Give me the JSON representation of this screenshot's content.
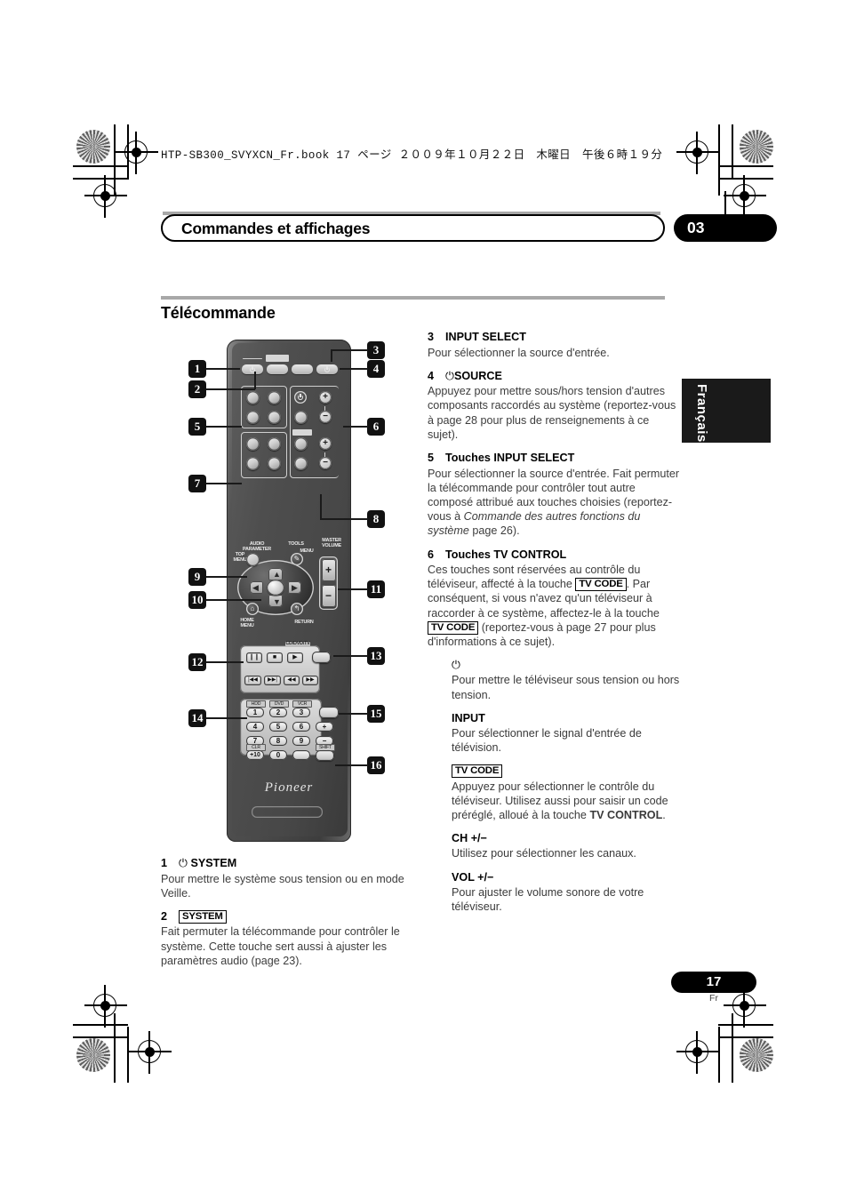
{
  "header": {
    "book_line": "HTP-SB300_SVYXCN_Fr.book   17 ページ   ２００９年１０月２２日　木曜日　午後６時１９分",
    "chapter_title": "Commandes et affichages",
    "chapter_number": "03",
    "language_tab": "Français"
  },
  "section": {
    "title": "Télécommande"
  },
  "footer": {
    "page_number": "17",
    "page_lang": "Fr"
  },
  "colors": {
    "accent_black": "#000000",
    "rule_gray": "#a8a8a8",
    "body_text": "#3d3d3d"
  },
  "callouts": [
    {
      "id": "1",
      "label": "1"
    },
    {
      "id": "2",
      "label": "2"
    },
    {
      "id": "3",
      "label": "3"
    },
    {
      "id": "4",
      "label": "4"
    },
    {
      "id": "5",
      "label": "5"
    },
    {
      "id": "6",
      "label": "6"
    },
    {
      "id": "7",
      "label": "7"
    },
    {
      "id": "8",
      "label": "8"
    },
    {
      "id": "9",
      "label": "9"
    },
    {
      "id": "10",
      "label": "10"
    },
    {
      "id": "11",
      "label": "11"
    },
    {
      "id": "12",
      "label": "12"
    },
    {
      "id": "13",
      "label": "13"
    },
    {
      "id": "14",
      "label": "14"
    },
    {
      "id": "15",
      "label": "15"
    },
    {
      "id": "16",
      "label": "16"
    }
  ],
  "remote": {
    "labels": {
      "audio_parameter": "AUDIO\nPARAMETER",
      "top_menu": "TOP\nMENU",
      "tools": "TOOLS",
      "menu": "MENU",
      "master_volume": "MASTER\nVOLUME",
      "home_menu": "HOME\nMENU",
      "return": "RETURN",
      "cd_dvd_tv": "CD/DVD/TV",
      "shift": "SHIFT",
      "clr": "CLR",
      "brand": "Pioneer"
    },
    "source_labels": [
      "HDD",
      "DVD",
      "VCR"
    ],
    "keypad": [
      "1",
      "2",
      "3",
      "4",
      "5",
      "6",
      "7",
      "8",
      "9",
      "+10",
      "0"
    ],
    "vol_plus": "+",
    "vol_minus": "−",
    "arrows": {
      "up": "▲",
      "down": "▼",
      "left": "◀",
      "right": "▶"
    },
    "transport": {
      "pause": "❙❙",
      "stop": "■",
      "play": "▶",
      "prev": "|◀◀",
      "next": "▶▶|",
      "rew": "◀◀",
      "ff": "▶▶"
    }
  },
  "left_column": [
    {
      "num": "1",
      "head_prefix": "⏻",
      "head": "SYSTEM",
      "body": "Pour mettre le système sous tension ou en mode Veille."
    },
    {
      "num": "2",
      "boxed": "SYSTEM",
      "body": "Fait permuter la télécommande pour contrôler le système. Cette touche sert aussi à ajuster les paramètres audio (page 23)."
    }
  ],
  "right_column": [
    {
      "num": "3",
      "head": "INPUT SELECT",
      "body": "Pour sélectionner la source d'entrée."
    },
    {
      "num": "4",
      "head_prefix": "⏻",
      "head": "SOURCE",
      "body": "Appuyez pour mettre sous/hors tension d'autres composants raccordés au système (reportez-vous à page 28 pour plus de renseignements à ce sujet)."
    },
    {
      "num": "5",
      "head": "Touches INPUT SELECT",
      "body_part1": "Pour sélectionner la source d'entrée. Fait permuter la télécommande pour contrôler tout autre composé attribué aux touches choisies (reportez-vous à ",
      "body_italic": "Commande des autres fonctions du système",
      "body_part2": " page 26)."
    },
    {
      "num": "6",
      "head": "Touches TV CONTROL",
      "body_part1": "Ces touches sont réservées au contrôle du téléviseur, affecté à la touche ",
      "boxed1": "TV CODE",
      "body_part2": ". Par conséquent, si vous n'avez qu'un téléviseur à raccorder à ce système, affectez-le à la touche ",
      "boxed2": "TV CODE",
      "body_part3": " (reportez-vous à page 27 pour plus d'informations à ce sujet)."
    }
  ],
  "subitems": [
    {
      "icon": "⏻",
      "body": "Pour mettre le téléviseur sous tension ou hors tension."
    },
    {
      "head": "INPUT",
      "body": "Pour sélectionner le signal d'entrée de télévision."
    },
    {
      "boxed_head": "TV CODE",
      "body_part1": "Appuyez pour sélectionner le contrôle du téléviseur. Utilisez aussi pour saisir un code préréglé, alloué à la touche ",
      "bold_tail": "TV CONTROL",
      "body_part2": "."
    },
    {
      "head": "CH +/−",
      "body": "Utilisez pour sélectionner les canaux."
    },
    {
      "head": "VOL +/−",
      "body": "Pour ajuster le volume sonore de votre téléviseur."
    }
  ]
}
